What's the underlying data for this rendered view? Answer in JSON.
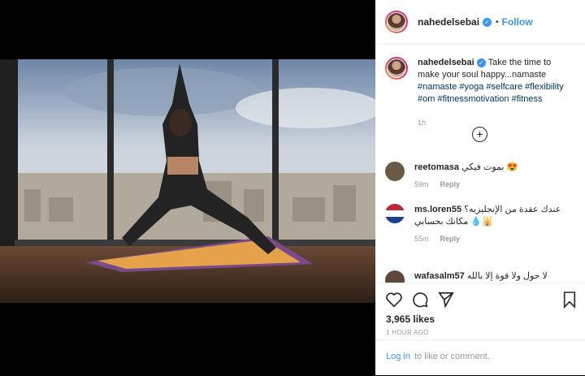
{
  "post": {
    "username": "nahedelsebai",
    "follow_label": "Follow",
    "bullet": "•",
    "caption_text": "Take the time to make your soul happy...namaste",
    "hashtags": [
      "#namaste",
      "#yoga",
      "#selfcare",
      "#flexibility",
      "#om",
      "#fitnessmotivation",
      "#fitness"
    ],
    "caption_time": "1h"
  },
  "comments": [
    {
      "user": "reetomasa",
      "text": "بموت فيكي 😍",
      "time": "59m",
      "reply": "Reply",
      "avatar_color": "#6b5a45"
    },
    {
      "user": "ms.loren55",
      "text": "عندك عقدة من الإنجليزيه؟ مكانك بحسابي 💧🕌",
      "time": "55m",
      "reply": "Reply",
      "avatar_color": "#c0283a"
    },
    {
      "user": "wafasalm57",
      "text": "لا حول ولا قوة إلا بالله",
      "time": "",
      "reply": "",
      "avatar_color": "#5d4a3d"
    }
  ],
  "actions": {
    "likes": "3,965 likes",
    "time_ago": "1 HOUR AGO"
  },
  "footer": {
    "login_link": "Log in",
    "login_text": "to like or comment."
  }
}
